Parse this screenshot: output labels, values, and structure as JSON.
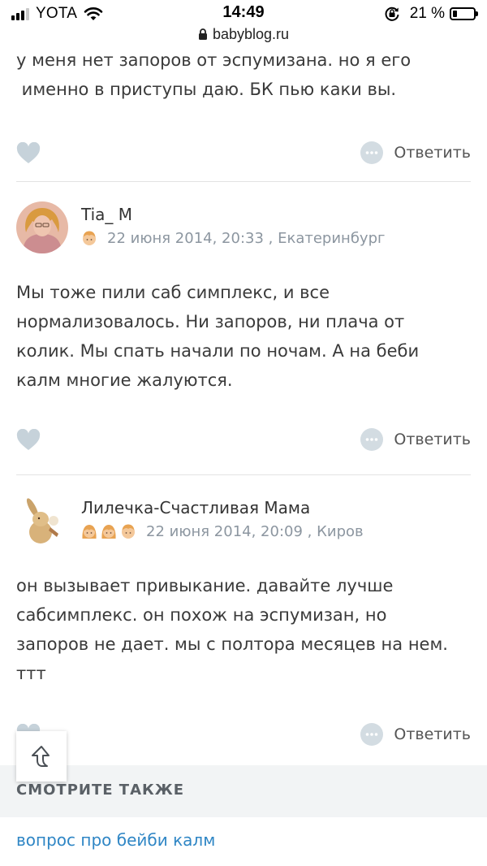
{
  "status_bar": {
    "carrier": "YOTA",
    "time": "14:49",
    "battery_percent": "21 %",
    "battery_level": 0.21
  },
  "browser": {
    "url": "babyblog.ru"
  },
  "comments": [
    {
      "text_lines": [
        "у меня нет запоров от эспумизана. но я его",
        " именно в приступы даю. БК пью каки вы."
      ],
      "reply_label": "Ответить"
    },
    {
      "author": "Tia_ M",
      "kids": [
        "boy-icon"
      ],
      "date_location": "22 июня 2014, 20:33 , Екатеринбург",
      "text_lines": [
        "Мы тоже пили саб симплекс, и все",
        "нормализовалось. Ни запоров, ни плача от",
        "колик. Мы спать начали по ночам. А на беби",
        "калм многие жалуются."
      ],
      "reply_label": "Ответить"
    },
    {
      "author": "Лилечка-Счастливая Мама",
      "kids": [
        "girl-icon",
        "girl-icon",
        "boy-icon"
      ],
      "date_location": "22 июня 2014, 20:09 , Киров",
      "text_lines": [
        "он вызывает привыкание. давайте лучше",
        "сабсимплекс. он похож на эспумизан, но",
        "запоров не дает. мы с полтора месяцев на нем.",
        "ттт"
      ],
      "reply_label": "Ответить"
    }
  ],
  "see_also": {
    "title": "СМОТРИТЕ ТАКЖЕ",
    "link": "вопрос про бейби калм"
  },
  "colors": {
    "icon_gray": "#c6d2da",
    "meta_text": "#8c96a0",
    "link": "#2f86c5",
    "see_also_bg": "#f2f4f5"
  }
}
